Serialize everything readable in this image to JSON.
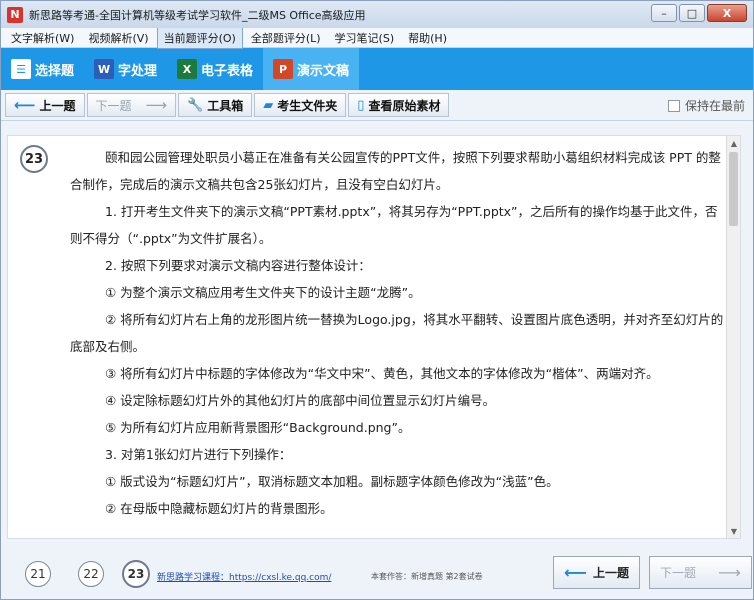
{
  "window": {
    "app_icon_letter": "N",
    "title": "新思路等考通-全国计算机等级考试学习软件_二级MS Office高级应用",
    "controls": [
      "–",
      "□",
      "X"
    ]
  },
  "menu": [
    {
      "label": "文字解析(W)",
      "active": false
    },
    {
      "label": "视频解析(V)",
      "active": false
    },
    {
      "label": "当前题评分(O)",
      "active": true
    },
    {
      "label": "全部题评分(L)",
      "active": false
    },
    {
      "label": "学习笔记(S)",
      "active": false
    },
    {
      "label": "帮助(H)",
      "active": false
    }
  ],
  "tabs": [
    {
      "label": "选择题",
      "icon": "list-icon",
      "icon_char": "☰"
    },
    {
      "label": "字处理",
      "icon": "word-icon",
      "icon_char": "W"
    },
    {
      "label": "电子表格",
      "icon": "excel-icon",
      "icon_char": "X"
    },
    {
      "label": "演示文稿",
      "icon": "powerpoint-icon",
      "icon_char": "P"
    }
  ],
  "toolbar": {
    "prev": "上一题",
    "next": "下一题",
    "tools": "工具箱",
    "folder": "考生文件夹",
    "source": "查看原始素材",
    "keep_on_top": "保持在最前"
  },
  "question": {
    "number": "23",
    "lines": [
      {
        "indent": true,
        "text": "颐和园公园管理处职员小葛正在准备有关公园宣传的PPT文件，按照下列要求帮助小葛组织材料完成该 PPT 的整合制作，完成后的演示文稿共包含25张幻灯片，且没有空白幻灯片。"
      },
      {
        "indent": true,
        "text": "1. 打开考生文件夹下的演示文稿“PPT素材.pptx”，将其另存为“PPT.pptx”，之后所有的操作均基于此文件，否则不得分（“.pptx”为文件扩展名）。"
      },
      {
        "indent": true,
        "text": "2. 按照下列要求对演示文稿内容进行整体设计："
      },
      {
        "indent": true,
        "text": "① 为整个演示文稿应用考生文件夹下的设计主题“龙腾”。"
      },
      {
        "indent": true,
        "text": "② 将所有幻灯片右上角的龙形图片统一替换为Logo.jpg，将其水平翻转、设置图片底色透明，并对齐至幻灯片的底部及右侧。"
      },
      {
        "indent": true,
        "text": "③ 将所有幻灯片中标题的字体修改为“华文中宋”、黄色，其他文本的字体修改为“楷体”、两端对齐。"
      },
      {
        "indent": true,
        "text": "④ 设定除标题幻灯片外的其他幻灯片的底部中间位置显示幻灯片编号。"
      },
      {
        "indent": true,
        "text": "⑤ 为所有幻灯片应用新背景图形“Background.png”。"
      },
      {
        "indent": true,
        "text": "3. 对第1张幻灯片进行下列操作："
      },
      {
        "indent": true,
        "text": "① 版式设为“标题幻灯片”，取消标题文本加粗。副标题字体颜色修改为“浅蓝”色。"
      },
      {
        "indent": true,
        "text": "② 在母版中隐藏标题幻灯片的背景图形。"
      }
    ]
  },
  "bottom": {
    "pages": [
      "21",
      "22",
      "23"
    ],
    "current_page": "23",
    "study_link": "新思路学习课程：https://cxsl.ke.qq.com/",
    "author": "本套作答：新增真题 第2套试卷",
    "prev": "上一题",
    "next": "下一题"
  }
}
